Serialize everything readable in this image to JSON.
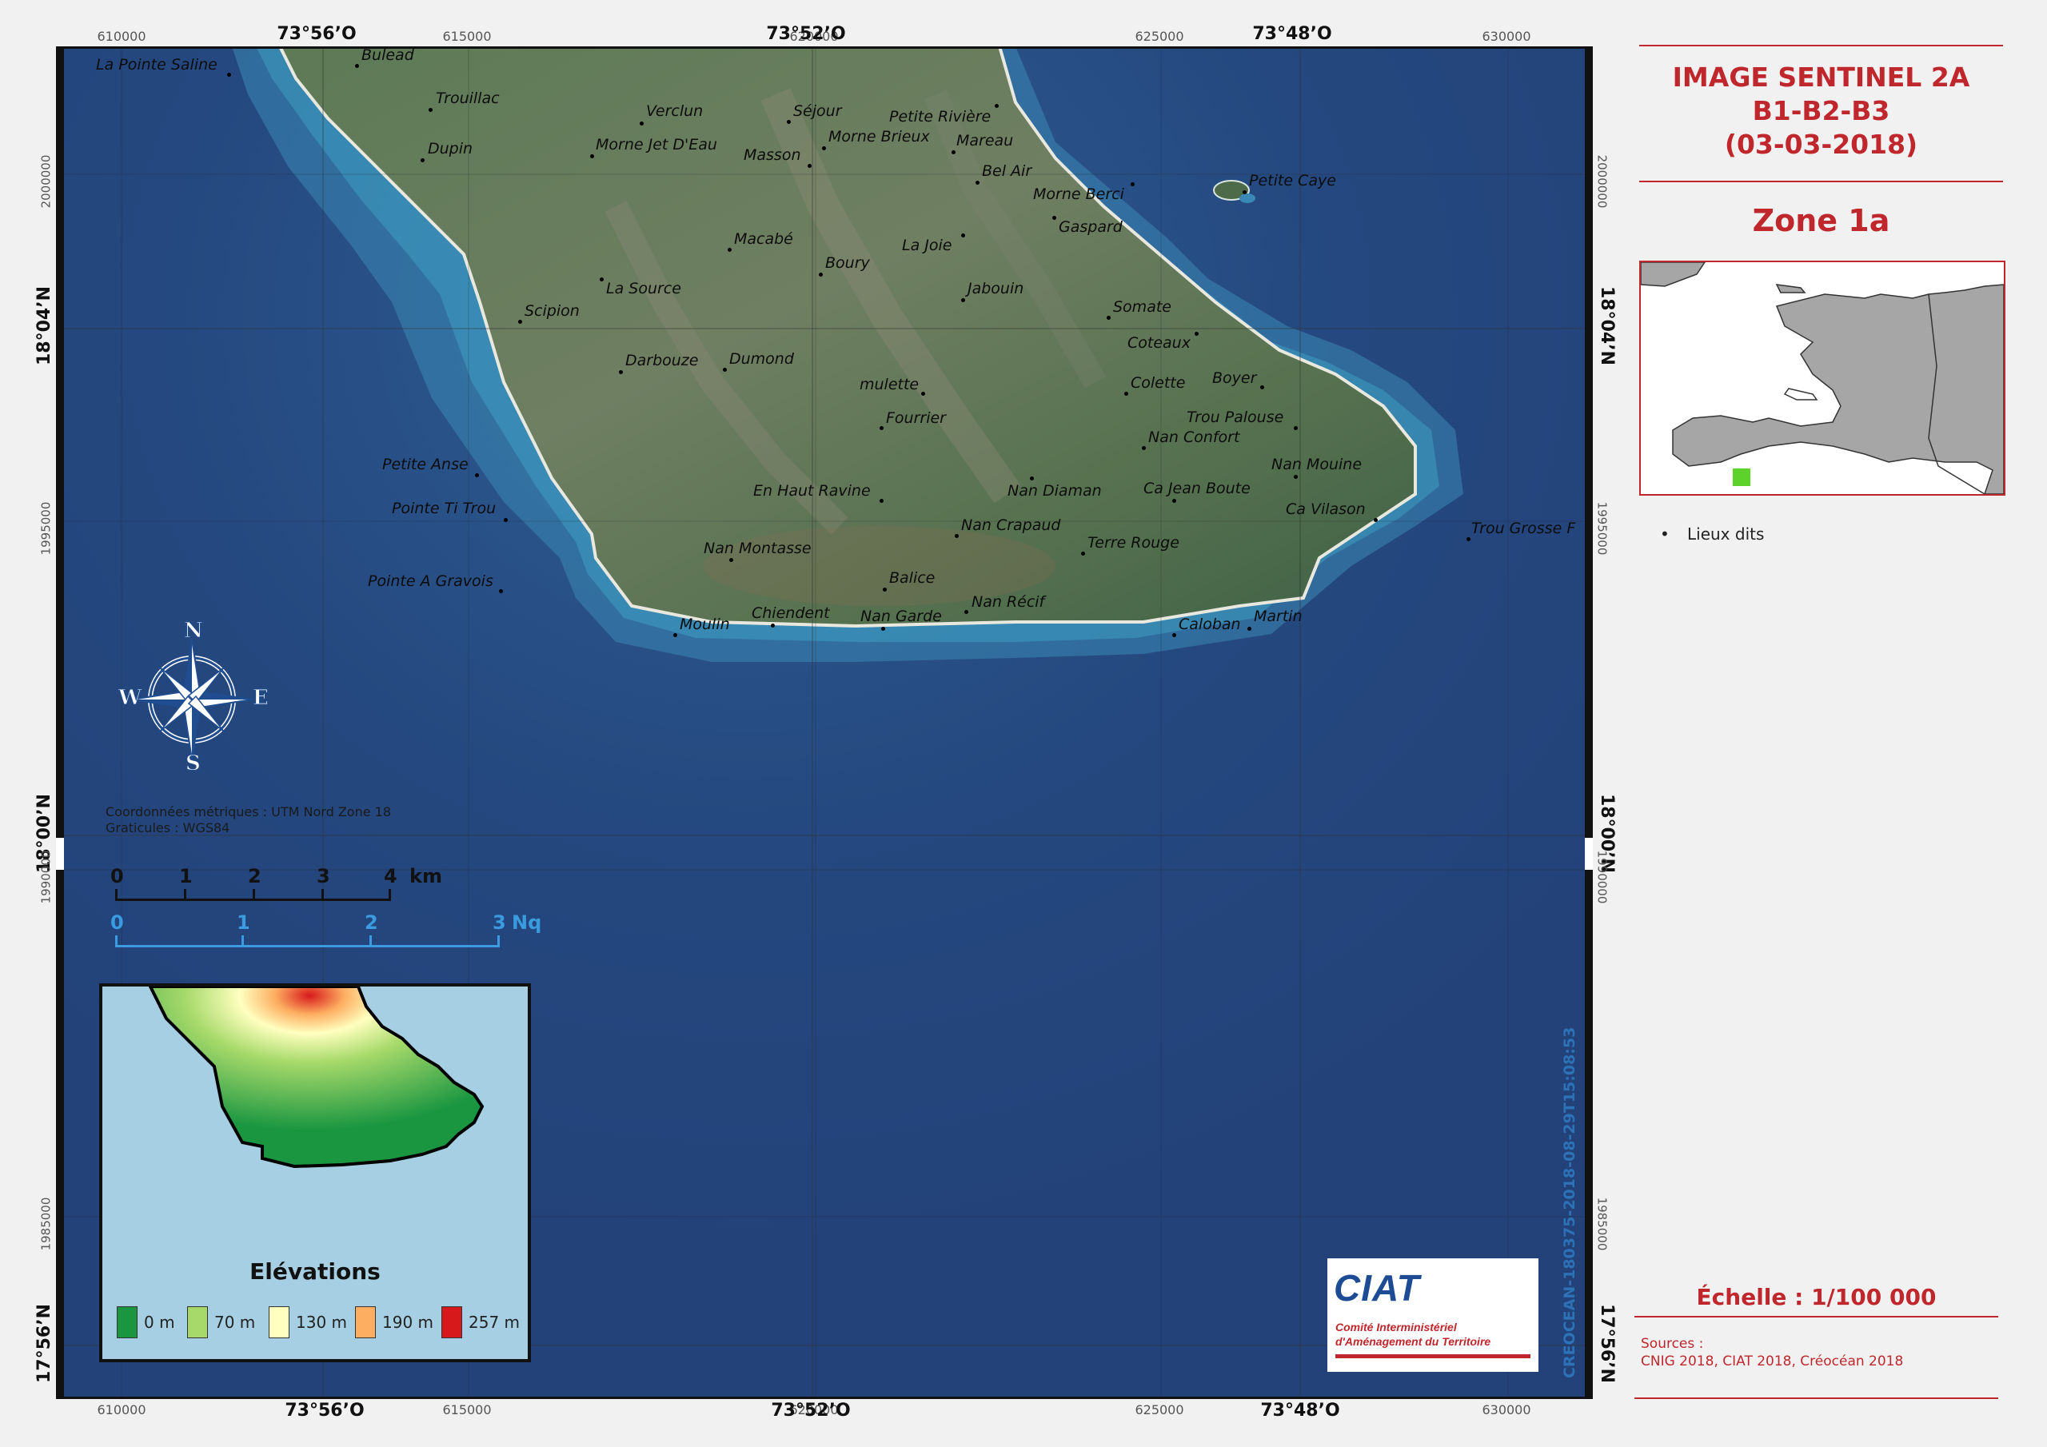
{
  "title": {
    "line1": "IMAGE SENTINEL 2A",
    "line2": "B1-B2-B3",
    "line3": "(03-03-2018)",
    "zone": "Zone 1a"
  },
  "legend": {
    "bullet_label": "Lieux dits"
  },
  "scale_text": "Échelle : 1/100 000",
  "sources": {
    "label": "Sources :",
    "text": "CNIG 2018, CIAT 2018, Créocéan 2018"
  },
  "projection": {
    "line1": "Coordonnées métriques : UTM Nord Zone 18",
    "line2": "Graticules : WGS84"
  },
  "grid": {
    "eastings": [
      "610000",
      "615000",
      "620000",
      "625000",
      "630000"
    ],
    "longitudes": [
      "73°56’O",
      "73°52’O",
      "73°48’O"
    ],
    "latitudes": [
      "18°04’N",
      "18°00’N",
      "17°56’N"
    ],
    "northings": [
      "2000000",
      "1995000",
      "1990000",
      "1985000"
    ]
  },
  "scalebar": {
    "km_ticks": [
      "0",
      "1",
      "2",
      "3",
      "4"
    ],
    "km_unit": "km",
    "nq_ticks": [
      "0",
      "1",
      "2",
      "3"
    ],
    "nq_unit": "Nq"
  },
  "compass": {
    "n": "N",
    "s": "S",
    "e": "E",
    "w": "W"
  },
  "elevation": {
    "title": "Elévations",
    "classes": [
      {
        "label": "0 m",
        "color": "#1a9641"
      },
      {
        "label": "70 m",
        "color": "#a6d96a"
      },
      {
        "label": "130 m",
        "color": "#ffffbf"
      },
      {
        "label": "190 m",
        "color": "#fdae61"
      },
      {
        "label": "257 m",
        "color": "#d7191c"
      }
    ]
  },
  "logo": {
    "name": "CIAT",
    "line1": "Comité Interministériel",
    "line2": "d'Aménagement du Territoire"
  },
  "vertical_stamp": "CREOCEAN-180375-2018-08-29T15:08:53",
  "places": [
    "La Pointe Saline",
    "Bulead",
    "Trouillac",
    "Dupin",
    "Verclun",
    "Séjour",
    "Petite Rivière",
    "Morne Jet D'Eau",
    "Morne Brieux",
    "Mareau",
    "Masson",
    "Bel Air",
    "Petite Caye",
    "Morne Berci",
    "Gaspard",
    "Macabé",
    "La Joie",
    "Boury",
    "La Source",
    "Jabouin",
    "Scipion",
    "Somate",
    "Coteaux",
    "Darbouze",
    "Dumond",
    "mulette",
    "Colette",
    "Boyer",
    "Fourrier",
    "Trou Palouse",
    "Nan Confort",
    "Petite Anse",
    "Nan Mouine",
    "En Haut Ravine",
    "Nan Diaman",
    "Ca Jean Boute",
    "Pointe Ti Trou",
    "Ca Vilason",
    "Trou Grosse F",
    "Nan Crapaud",
    "Terre Rouge",
    "Nan Montasse",
    "Pointe A Gravois",
    "Balice",
    "Nan Récif",
    "Chiendent",
    "Nan Garde",
    "Moulin",
    "Caloban",
    "Martin"
  ],
  "colors": {
    "accent": "#c0272d",
    "sea": "#23467e",
    "land": "#4d6b48",
    "inset_sea": "#a6cfe3"
  }
}
